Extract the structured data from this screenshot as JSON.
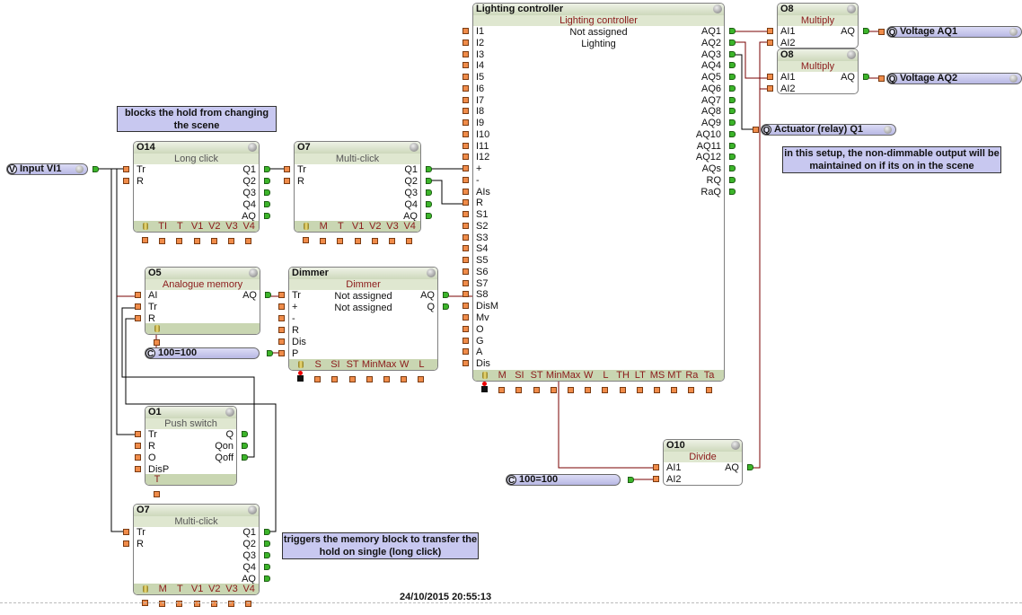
{
  "blocks": [
    {
      "key": "o14",
      "title": "O14",
      "subtitle": "Long click",
      "sub_color": "gray",
      "inputs": [
        "Tr",
        "R"
      ],
      "outputs": [
        "Q1",
        "Q2",
        "Q3",
        "Q4",
        "AQ"
      ],
      "params": [
        "TI",
        "T",
        "V1",
        "V2",
        "V3",
        "V4"
      ],
      "param_icon": true,
      "info_lines": []
    },
    {
      "key": "o7a",
      "title": "O7",
      "subtitle": "Multi-click",
      "sub_color": "gray",
      "inputs": [
        "Tr",
        "R"
      ],
      "outputs": [
        "Q1",
        "Q2",
        "Q3",
        "Q4",
        "AQ"
      ],
      "params": [
        "M",
        "T",
        "V1",
        "V2",
        "V3",
        "V4"
      ],
      "param_icon": true,
      "info_lines": []
    },
    {
      "key": "lc",
      "title": "Lighting controller",
      "subtitle": "Lighting controller",
      "sub_color": "red",
      "inputs": [
        "I1",
        "I2",
        "I3",
        "I4",
        "I5",
        "I6",
        "I7",
        "I8",
        "I9",
        "I10",
        "I11",
        "I12",
        "+",
        "-",
        "AIs",
        "R",
        "S1",
        "S2",
        "S3",
        "S4",
        "S5",
        "S6",
        "S7",
        "S8",
        "DisM",
        "Mv",
        "O",
        "G",
        "A",
        "Dis"
      ],
      "outputs": [
        "AQ1",
        "AQ2",
        "AQ3",
        "AQ4",
        "AQ5",
        "AQ6",
        "AQ7",
        "AQ8",
        "AQ9",
        "AQ10",
        "AQ11",
        "AQ12",
        "AQs",
        "RQ",
        "RaQ"
      ],
      "params": [
        "M",
        "SI",
        "ST",
        "Min",
        "Max",
        "W",
        "L",
        "TH",
        "LT",
        "MS",
        "MT",
        "Ra",
        "Ta"
      ],
      "param_icon": true,
      "icon_pin_black": true,
      "info_lines": [
        "Not assigned",
        "Lighting"
      ]
    },
    {
      "key": "m1",
      "title": "O8",
      "subtitle": "Multiply",
      "sub_color": "red",
      "inputs": [
        "AI1",
        "AI2"
      ],
      "outputs": [
        "AQ"
      ],
      "params": [],
      "param_icon": false,
      "info_lines": []
    },
    {
      "key": "m2",
      "title": "O8",
      "subtitle": "Multiply",
      "sub_color": "red",
      "inputs": [
        "AI1",
        "AI2"
      ],
      "outputs": [
        "AQ"
      ],
      "params": [],
      "param_icon": false,
      "info_lines": []
    },
    {
      "key": "o5",
      "title": "O5",
      "subtitle": "Analogue memory",
      "sub_color": "red",
      "inputs": [
        "AI",
        "Tr",
        "R"
      ],
      "outputs": [
        "AQ"
      ],
      "params": [],
      "param_icon": true,
      "info_lines": []
    },
    {
      "key": "dim",
      "title": "Dimmer",
      "subtitle": "Dimmer",
      "sub_color": "red",
      "inputs": [
        "Tr",
        "+",
        "-",
        "R",
        "Dis",
        "P"
      ],
      "outputs": [
        "AQ",
        "Q"
      ],
      "params": [
        "S",
        "SI",
        "ST",
        "Min",
        "Max",
        "W",
        "L"
      ],
      "param_icon": true,
      "icon_pin_black": true,
      "info_lines": [
        "Not assigned",
        "Not assigned"
      ]
    },
    {
      "key": "o1",
      "title": "O1",
      "subtitle": "Push switch",
      "sub_color": "gray",
      "inputs": [
        "Tr",
        "R",
        "O",
        "DisP"
      ],
      "outputs": [
        "Q",
        "Qon",
        "Qoff"
      ],
      "params": [
        "T"
      ],
      "param_icon": false,
      "info_lines": []
    },
    {
      "key": "o7b",
      "title": "O7",
      "subtitle": "Multi-click",
      "sub_color": "gray",
      "inputs": [
        "Tr",
        "R"
      ],
      "outputs": [
        "Q1",
        "Q2",
        "Q3",
        "Q4",
        "AQ"
      ],
      "params": [
        "M",
        "T",
        "V1",
        "V2",
        "V3",
        "V4"
      ],
      "param_icon": true,
      "info_lines": []
    },
    {
      "key": "o10",
      "title": "O10",
      "subtitle": "Divide",
      "sub_color": "red",
      "inputs": [
        "AI1",
        "AI2"
      ],
      "outputs": [
        "AQ"
      ],
      "params": [],
      "param_icon": false,
      "info_lines": []
    }
  ],
  "terminals": [
    {
      "key": "vi1",
      "letter": "V",
      "label": "Input VI1",
      "info": true
    },
    {
      "key": "aq1",
      "letter": "Q",
      "label": "Voltage AQ1",
      "info": true
    },
    {
      "key": "aq2",
      "letter": "Q",
      "label": "Voltage AQ2",
      "info": true
    },
    {
      "key": "q1",
      "letter": "Q",
      "label": "Actuator (relay) Q1",
      "info": true
    },
    {
      "key": "c1",
      "letter": "C",
      "label": "100=100",
      "info": false
    },
    {
      "key": "c2",
      "letter": "C",
      "label": "100=100",
      "info": false
    }
  ],
  "notes": [
    {
      "key": "n1",
      "text": "blocks the hold from changing the scene"
    },
    {
      "key": "n2",
      "text": "in this setup, the non-dimmable output will be maintained on if its on in the scene"
    },
    {
      "key": "n3",
      "text": "triggers the memory block to transfer the hold on single (long click)"
    }
  ],
  "timestamp": "24/10/2015 20:55:13",
  "colors": {
    "digital_wire": "#000000",
    "analog_wire": "#7a0000",
    "input_pin": "#f08c4a",
    "output_pin": "#3cb52a",
    "note_bg": "#c8c8f0",
    "block_header": "#cdd8bb"
  }
}
